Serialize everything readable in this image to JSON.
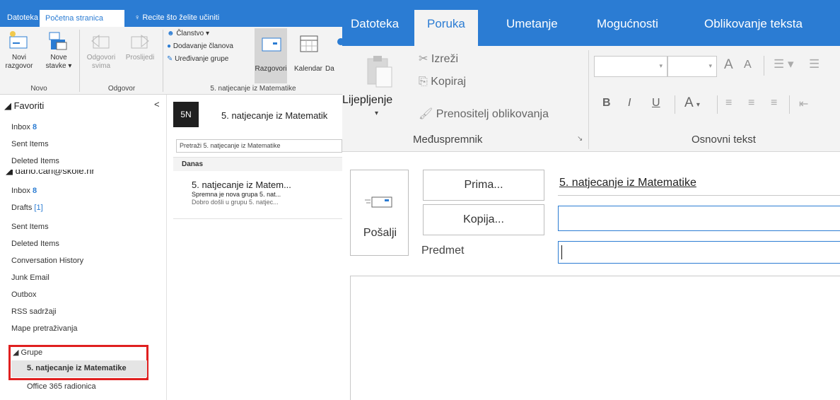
{
  "left": {
    "tabs": [
      "Datoteka",
      "Početna stranica"
    ],
    "tell_me": "Recite što želite učiniti",
    "ribbon": {
      "novi_razgovor": [
        "Novi",
        "razgovor"
      ],
      "nove_stavke": [
        "Nove",
        "stavke ▾"
      ],
      "odgovori_svima": [
        "Odgovori",
        "svima"
      ],
      "proslijedi": "Proslijedi",
      "clanstvo": "Članstvo ▾",
      "dodavanje": "Dodavanje članova",
      "uredivanje": "Uređivanje grupe",
      "razgovori": "Razgovori",
      "kalendar": "Kalendar",
      "da": "Da",
      "group_novo": "Novo",
      "group_odgovor": "Odgovor",
      "group_name": "5. natjecanje iz Matematike"
    },
    "nav": {
      "favoriti": "◢ Favoriti",
      "collapse": "<",
      "inbox_label": "Inbox",
      "inbox_count": "8",
      "sent": "Sent Items",
      "deleted": "Deleted Items",
      "account": "◢ dario.cari@skole.hr",
      "inbox2_label": "Inbox",
      "inbox2_count": "8",
      "drafts_label": "Drafts",
      "drafts_count": "[1]",
      "sent2": "Sent Items",
      "deleted2": "Deleted Items",
      "conv": "Conversation History",
      "junk": "Junk Email",
      "outbox": "Outbox",
      "rss": "RSS sadržaji",
      "mape": "Mape pretraživanja",
      "grupe": "◢ Grupe",
      "group1": "5. natjecanje iz Matematike",
      "group2": "Office 365 radionica"
    },
    "list": {
      "avatar": "5N",
      "header_title": "5. natjecanje iz Matematik",
      "search": "Pretraži 5. natjecanje iz Matematike",
      "date_group": "Danas",
      "item_title": "5. natjecanje iz Matem...",
      "item_line1": "Spremna je nova grupa 5. nat...",
      "item_line2": "Dobro došli u grupu 5. natjec..."
    }
  },
  "right": {
    "tabs": [
      "Datoteka",
      "Poruka",
      "Umetanje",
      "Mogućnosti",
      "Oblikovanje teksta"
    ],
    "paste_label": "Lijepljenje",
    "paste_arrow": "▾",
    "izrezi": "Izreži",
    "kopiraj": "Kopiraj",
    "prenositelj": "Prenositelj oblikovanja",
    "group_clipboard": "Međuspremnik",
    "group_basic": "Osnovni tekst",
    "bold": "B",
    "italic": "I",
    "underline": "U",
    "font_color": "A",
    "grow": "A",
    "shrink": "A",
    "posalji": "Pošalji",
    "prima": "Prima...",
    "kopija": "Kopija...",
    "predmet": "Predmet",
    "to_value": "5. natjecanje iz Matematike",
    "cc_value": "",
    "subject_value": ""
  },
  "colors": {
    "accent": "#2b7cd3",
    "highlight_border": "#e02020",
    "selected_bg": "#e5e5e5"
  }
}
